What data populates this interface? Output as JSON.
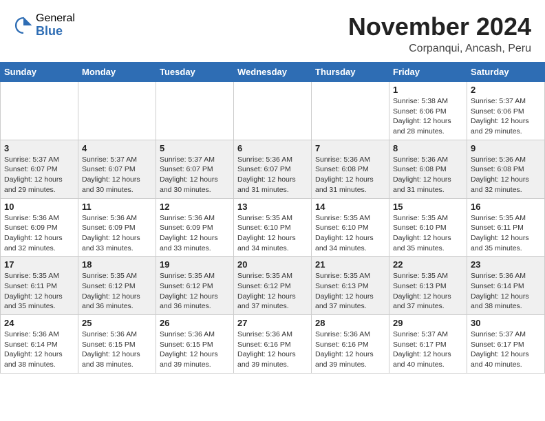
{
  "logo": {
    "general": "General",
    "blue": "Blue"
  },
  "title": {
    "month": "November 2024",
    "location": "Corpanqui, Ancash, Peru"
  },
  "headers": [
    "Sunday",
    "Monday",
    "Tuesday",
    "Wednesday",
    "Thursday",
    "Friday",
    "Saturday"
  ],
  "weeks": [
    [
      {
        "day": "",
        "info": ""
      },
      {
        "day": "",
        "info": ""
      },
      {
        "day": "",
        "info": ""
      },
      {
        "day": "",
        "info": ""
      },
      {
        "day": "",
        "info": ""
      },
      {
        "day": "1",
        "info": "Sunrise: 5:38 AM\nSunset: 6:06 PM\nDaylight: 12 hours\nand 28 minutes."
      },
      {
        "day": "2",
        "info": "Sunrise: 5:37 AM\nSunset: 6:06 PM\nDaylight: 12 hours\nand 29 minutes."
      }
    ],
    [
      {
        "day": "3",
        "info": "Sunrise: 5:37 AM\nSunset: 6:07 PM\nDaylight: 12 hours\nand 29 minutes."
      },
      {
        "day": "4",
        "info": "Sunrise: 5:37 AM\nSunset: 6:07 PM\nDaylight: 12 hours\nand 30 minutes."
      },
      {
        "day": "5",
        "info": "Sunrise: 5:37 AM\nSunset: 6:07 PM\nDaylight: 12 hours\nand 30 minutes."
      },
      {
        "day": "6",
        "info": "Sunrise: 5:36 AM\nSunset: 6:07 PM\nDaylight: 12 hours\nand 31 minutes."
      },
      {
        "day": "7",
        "info": "Sunrise: 5:36 AM\nSunset: 6:08 PM\nDaylight: 12 hours\nand 31 minutes."
      },
      {
        "day": "8",
        "info": "Sunrise: 5:36 AM\nSunset: 6:08 PM\nDaylight: 12 hours\nand 31 minutes."
      },
      {
        "day": "9",
        "info": "Sunrise: 5:36 AM\nSunset: 6:08 PM\nDaylight: 12 hours\nand 32 minutes."
      }
    ],
    [
      {
        "day": "10",
        "info": "Sunrise: 5:36 AM\nSunset: 6:09 PM\nDaylight: 12 hours\nand 32 minutes."
      },
      {
        "day": "11",
        "info": "Sunrise: 5:36 AM\nSunset: 6:09 PM\nDaylight: 12 hours\nand 33 minutes."
      },
      {
        "day": "12",
        "info": "Sunrise: 5:36 AM\nSunset: 6:09 PM\nDaylight: 12 hours\nand 33 minutes."
      },
      {
        "day": "13",
        "info": "Sunrise: 5:35 AM\nSunset: 6:10 PM\nDaylight: 12 hours\nand 34 minutes."
      },
      {
        "day": "14",
        "info": "Sunrise: 5:35 AM\nSunset: 6:10 PM\nDaylight: 12 hours\nand 34 minutes."
      },
      {
        "day": "15",
        "info": "Sunrise: 5:35 AM\nSunset: 6:10 PM\nDaylight: 12 hours\nand 35 minutes."
      },
      {
        "day": "16",
        "info": "Sunrise: 5:35 AM\nSunset: 6:11 PM\nDaylight: 12 hours\nand 35 minutes."
      }
    ],
    [
      {
        "day": "17",
        "info": "Sunrise: 5:35 AM\nSunset: 6:11 PM\nDaylight: 12 hours\nand 35 minutes."
      },
      {
        "day": "18",
        "info": "Sunrise: 5:35 AM\nSunset: 6:12 PM\nDaylight: 12 hours\nand 36 minutes."
      },
      {
        "day": "19",
        "info": "Sunrise: 5:35 AM\nSunset: 6:12 PM\nDaylight: 12 hours\nand 36 minutes."
      },
      {
        "day": "20",
        "info": "Sunrise: 5:35 AM\nSunset: 6:12 PM\nDaylight: 12 hours\nand 37 minutes."
      },
      {
        "day": "21",
        "info": "Sunrise: 5:35 AM\nSunset: 6:13 PM\nDaylight: 12 hours\nand 37 minutes."
      },
      {
        "day": "22",
        "info": "Sunrise: 5:35 AM\nSunset: 6:13 PM\nDaylight: 12 hours\nand 37 minutes."
      },
      {
        "day": "23",
        "info": "Sunrise: 5:36 AM\nSunset: 6:14 PM\nDaylight: 12 hours\nand 38 minutes."
      }
    ],
    [
      {
        "day": "24",
        "info": "Sunrise: 5:36 AM\nSunset: 6:14 PM\nDaylight: 12 hours\nand 38 minutes."
      },
      {
        "day": "25",
        "info": "Sunrise: 5:36 AM\nSunset: 6:15 PM\nDaylight: 12 hours\nand 38 minutes."
      },
      {
        "day": "26",
        "info": "Sunrise: 5:36 AM\nSunset: 6:15 PM\nDaylight: 12 hours\nand 39 minutes."
      },
      {
        "day": "27",
        "info": "Sunrise: 5:36 AM\nSunset: 6:16 PM\nDaylight: 12 hours\nand 39 minutes."
      },
      {
        "day": "28",
        "info": "Sunrise: 5:36 AM\nSunset: 6:16 PM\nDaylight: 12 hours\nand 39 minutes."
      },
      {
        "day": "29",
        "info": "Sunrise: 5:37 AM\nSunset: 6:17 PM\nDaylight: 12 hours\nand 40 minutes."
      },
      {
        "day": "30",
        "info": "Sunrise: 5:37 AM\nSunset: 6:17 PM\nDaylight: 12 hours\nand 40 minutes."
      }
    ]
  ]
}
